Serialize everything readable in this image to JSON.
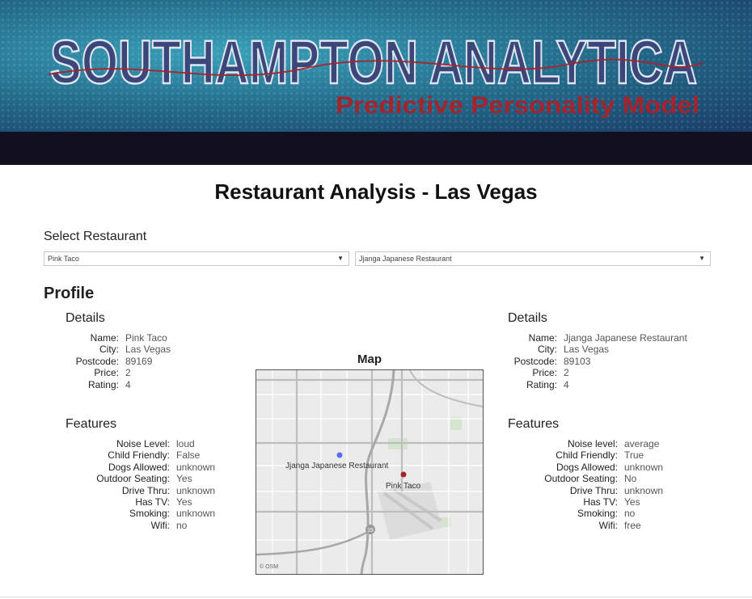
{
  "banner": {
    "title": "SOUTHAMPTON ANALYTICA",
    "subtitle": "Predictive Personality Model",
    "colors": {
      "title_fill": "#3a4778",
      "subtitle": "#a5232b",
      "darkbar": "#120f1e"
    }
  },
  "page": {
    "title": "Restaurant Analysis - Las Vegas"
  },
  "select": {
    "label": "Select Restaurant",
    "left_value": "Pink Taco",
    "right_value": "Jjanga Japanese Restaurant",
    "arrow_icon": "caret-down-icon"
  },
  "profile": {
    "heading": "Profile"
  },
  "left": {
    "details_title": "Details",
    "details": [
      {
        "key": "Name:",
        "value": "Pink Taco"
      },
      {
        "key": "City:",
        "value": "Las Vegas"
      },
      {
        "key": "Postcode:",
        "value": "89169"
      },
      {
        "key": "Price:",
        "value": "2"
      },
      {
        "key": "Rating:",
        "value": "4"
      }
    ],
    "features_title": "Features",
    "features": [
      {
        "key": "Noise Level:",
        "value": "loud"
      },
      {
        "key": "Child Friendly:",
        "value": "False"
      },
      {
        "key": "Dogs Allowed:",
        "value": "unknown"
      },
      {
        "key": "Outdoor Seating:",
        "value": "Yes"
      },
      {
        "key": "Drive Thru:",
        "value": "unknown"
      },
      {
        "key": "Has TV:",
        "value": "Yes"
      },
      {
        "key": "Smoking:",
        "value": "unknown"
      },
      {
        "key": "Wifi:",
        "value": "no"
      }
    ]
  },
  "right": {
    "details_title": "Details",
    "details": [
      {
        "key": "Name:",
        "value": "Jjanga Japanese Restaurant"
      },
      {
        "key": "City:",
        "value": "Las Vegas"
      },
      {
        "key": "Postcode:",
        "value": "89103"
      },
      {
        "key": "Price:",
        "value": "2"
      },
      {
        "key": "Rating:",
        "value": "4"
      }
    ],
    "features_title": "Features",
    "features": [
      {
        "key": "Noise level:",
        "value": "average"
      },
      {
        "key": "Child Friendly:",
        "value": "True"
      },
      {
        "key": "Dogs Allowed:",
        "value": "unknown"
      },
      {
        "key": "Outdoor Seating:",
        "value": "No"
      },
      {
        "key": "Drive Thru:",
        "value": "unknown"
      },
      {
        "key": "Has TV:",
        "value": "Yes"
      },
      {
        "key": "Smoking:",
        "value": "no"
      },
      {
        "key": "Wifi:",
        "value": "free"
      }
    ]
  },
  "map": {
    "title": "Map",
    "attribution": "© OSM",
    "highway_shield": "15",
    "markers": [
      {
        "label": "Jjanga Japanese Restaurant",
        "color": "#5a6cf5"
      },
      {
        "label": "Pink Taco",
        "color": "#a5232b"
      }
    ]
  }
}
